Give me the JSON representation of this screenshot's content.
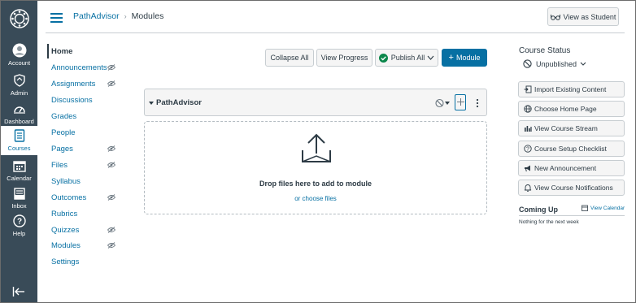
{
  "global_nav": {
    "items": [
      {
        "label": "Account",
        "icon": "account-icon"
      },
      {
        "label": "Admin",
        "icon": "admin-icon"
      },
      {
        "label": "Dashboard",
        "icon": "dashboard-icon"
      },
      {
        "label": "Courses",
        "icon": "courses-icon",
        "active": true
      },
      {
        "label": "Calendar",
        "icon": "calendar-icon"
      },
      {
        "label": "Inbox",
        "icon": "inbox-icon"
      },
      {
        "label": "Help",
        "icon": "help-icon"
      }
    ]
  },
  "header": {
    "breadcrumb_course": "PathAdvisor",
    "breadcrumb_separator": "›",
    "breadcrumb_current": "Modules",
    "view_as_student": "View as Student"
  },
  "course_nav": {
    "items": [
      {
        "label": "Home",
        "active": true,
        "hidden_icon": false
      },
      {
        "label": "Announcements",
        "hidden_icon": true
      },
      {
        "label": "Assignments",
        "hidden_icon": true
      },
      {
        "label": "Discussions",
        "hidden_icon": false
      },
      {
        "label": "Grades",
        "hidden_icon": false
      },
      {
        "label": "People",
        "hidden_icon": false
      },
      {
        "label": "Pages",
        "hidden_icon": true
      },
      {
        "label": "Files",
        "hidden_icon": true
      },
      {
        "label": "Syllabus",
        "hidden_icon": false
      },
      {
        "label": "Outcomes",
        "hidden_icon": true
      },
      {
        "label": "Rubrics",
        "hidden_icon": false
      },
      {
        "label": "Quizzes",
        "hidden_icon": true
      },
      {
        "label": "Modules",
        "hidden_icon": true
      },
      {
        "label": "Settings",
        "hidden_icon": false
      }
    ]
  },
  "toolbar": {
    "collapse_all": "Collapse All",
    "view_progress": "View Progress",
    "publish_all": "Publish All",
    "add_module": "Module"
  },
  "module": {
    "title": "PathAdvisor",
    "drop_text": "Drop files here to add to module",
    "choose_files": "or choose files"
  },
  "sidebar": {
    "course_status_heading": "Course Status",
    "status_value": "Unpublished",
    "buttons": [
      {
        "label": "Import Existing Content",
        "icon": "import-icon"
      },
      {
        "label": "Choose Home Page",
        "icon": "home-page-icon"
      },
      {
        "label": "View Course Stream",
        "icon": "stream-icon"
      },
      {
        "label": "Course Setup Checklist",
        "icon": "checklist-icon"
      },
      {
        "label": "New Announcement",
        "icon": "announcement-icon"
      },
      {
        "label": "View Course Notifications",
        "icon": "bell-icon"
      }
    ],
    "coming_up_heading": "Coming Up",
    "view_calendar": "View Calendar",
    "coming_up_empty": "Nothing for the next week"
  },
  "colors": {
    "nav_bg": "#394b58",
    "link_blue": "#0770a3",
    "publish_green": "#0b874b",
    "text_dark": "#2d3b45"
  }
}
